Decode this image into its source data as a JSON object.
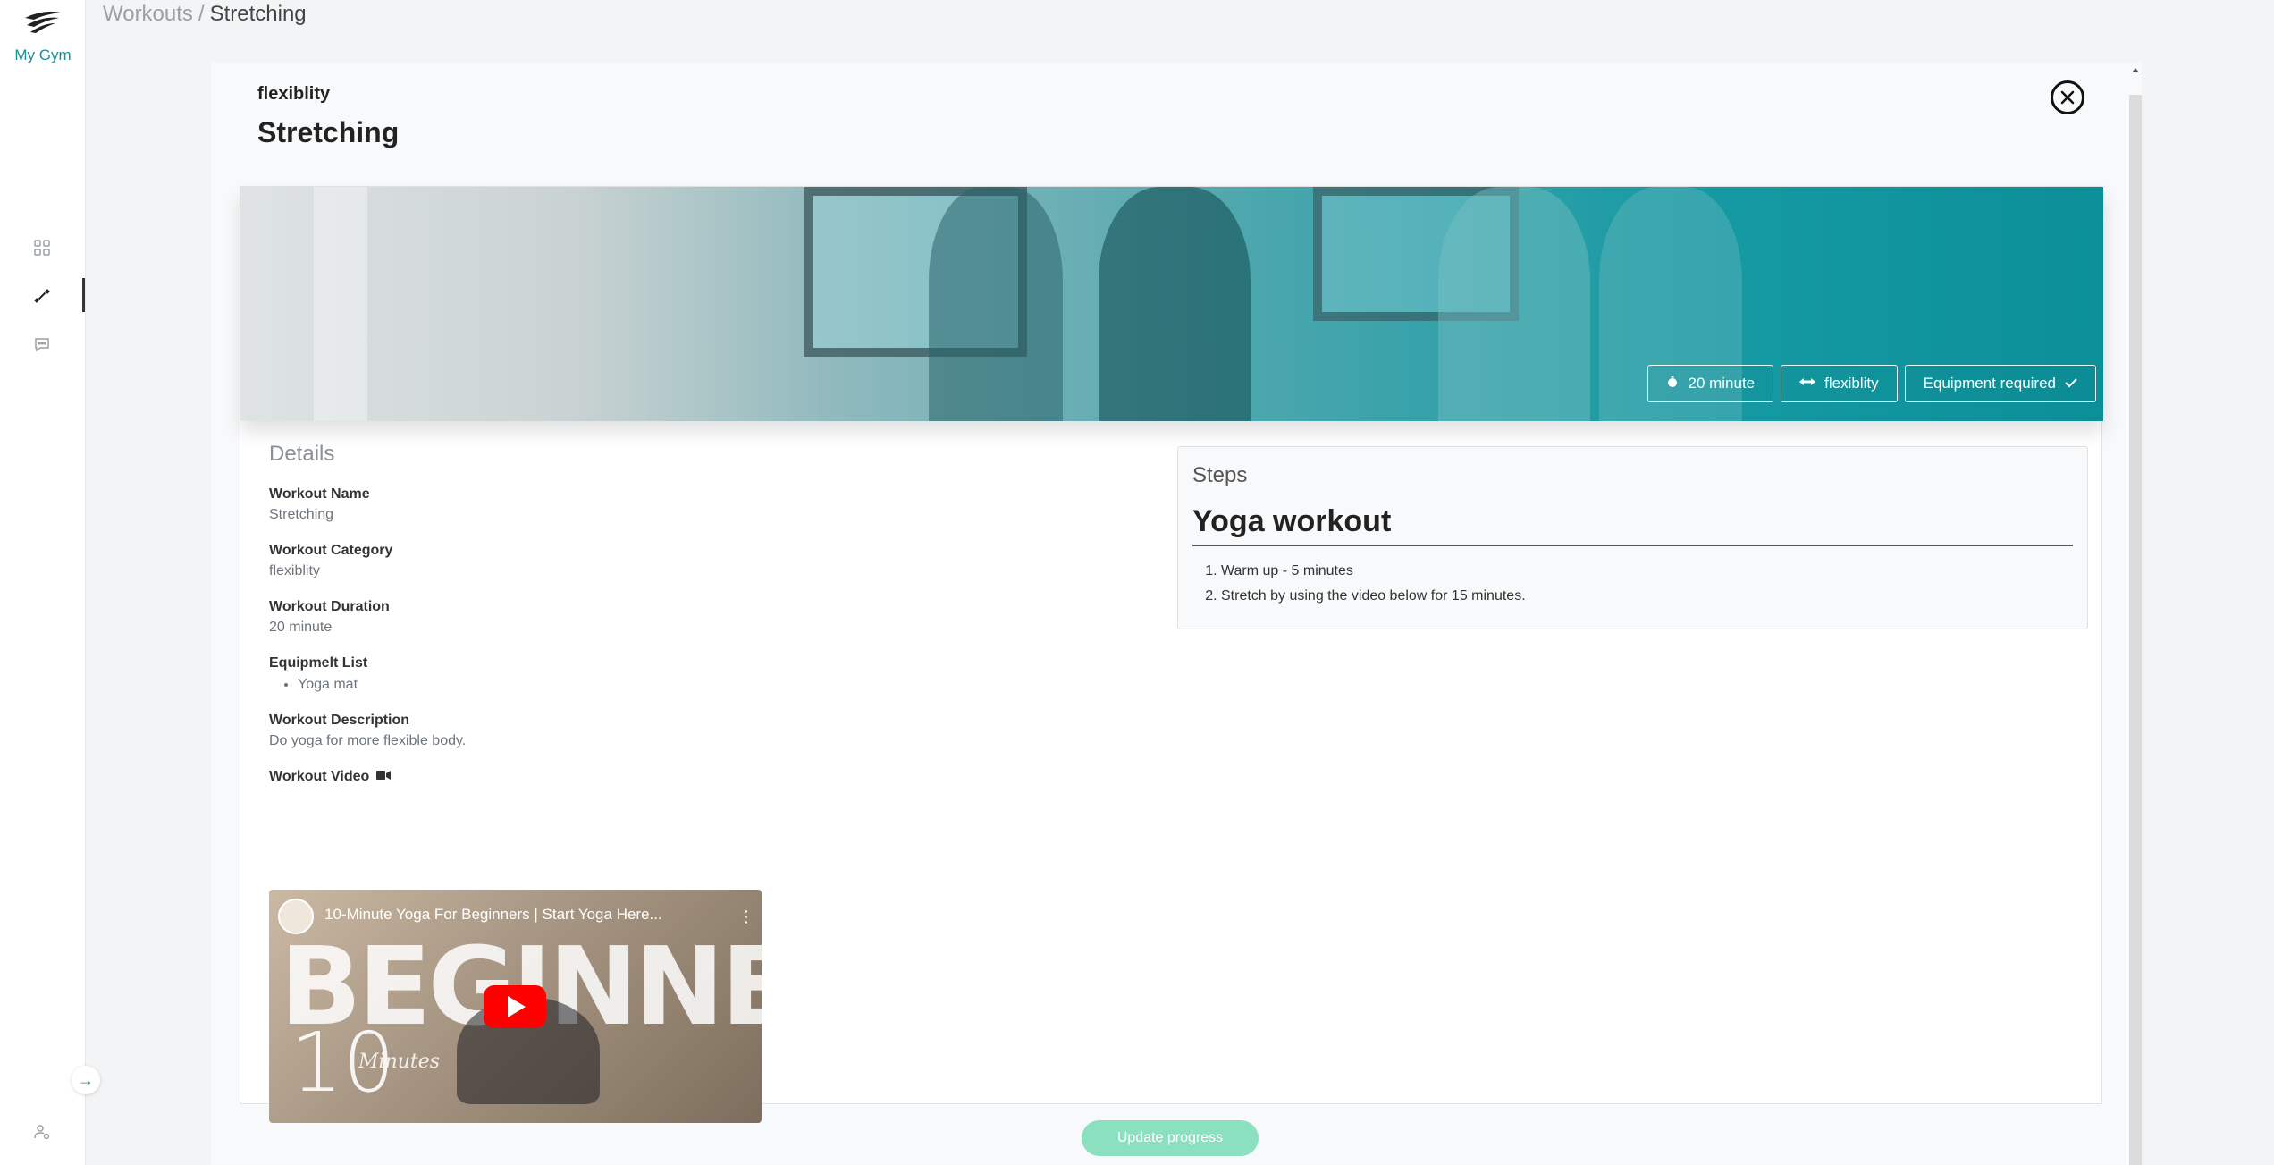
{
  "app": {
    "name": "My Gym"
  },
  "breadcrumb": {
    "parent": "Workouts",
    "separator": "/",
    "current": "Stretching"
  },
  "modal": {
    "category": "flexiblity",
    "title": "Stretching",
    "badges": {
      "duration": "20 minute",
      "category": "flexiblity",
      "equipment": "Equipment required"
    },
    "details": {
      "heading": "Details",
      "workout_name_label": "Workout Name",
      "workout_name": "Stretching",
      "workout_category_label": "Workout Category",
      "workout_category": "flexiblity",
      "workout_duration_label": "Workout Duration",
      "workout_duration": "20 minute",
      "equipment_label": "Equipmelt List",
      "equipment_items": [
        "Yoga mat"
      ],
      "description_label": "Workout Description",
      "description": "Do yoga for more flexible body.",
      "video_label": "Workout Video"
    },
    "video": {
      "title": "10-Minute Yoga For Beginners | Start Yoga Here...",
      "overlay_big": "BEGINNERS",
      "overlay_num": "10",
      "overlay_sub": "Minutes"
    },
    "steps": {
      "heading": "Steps",
      "title": "Yoga workout",
      "items": [
        "Warm up - 5 minutes",
        "Stretch by using the video below for 15 minutes."
      ]
    },
    "update_button": "Update progress"
  },
  "colors": {
    "accent": "#1a8f96",
    "button": "#8be0c0"
  }
}
